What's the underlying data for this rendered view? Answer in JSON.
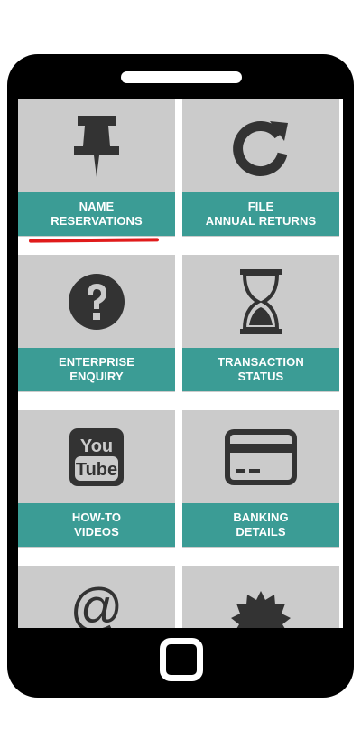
{
  "tiles": [
    {
      "icon": "pushpin-icon",
      "line1": "NAME",
      "line2": "RESERVATIONS"
    },
    {
      "icon": "refresh-icon",
      "line1": "FILE",
      "line2": "ANNUAL RETURNS"
    },
    {
      "icon": "question-circle-icon",
      "line1": "ENTERPRISE",
      "line2": "ENQUIRY"
    },
    {
      "icon": "hourglass-icon",
      "line1": "TRANSACTION",
      "line2": "STATUS"
    },
    {
      "icon": "youtube-icon",
      "line1": "HOW-TO",
      "line2": "VIDEOS"
    },
    {
      "icon": "credit-card-icon",
      "line1": "BANKING",
      "line2": "DETAILS"
    },
    {
      "icon": "at-sign-icon",
      "glyph": "@"
    },
    {
      "icon": "badge-icon"
    }
  ],
  "youtube_logo": {
    "top": "You",
    "bottom": "Tube"
  },
  "colors": {
    "tile_bg": "#cbcbcb",
    "label_bg": "#3b9c95",
    "icon": "#333333",
    "highlight": "#e01b1b"
  }
}
